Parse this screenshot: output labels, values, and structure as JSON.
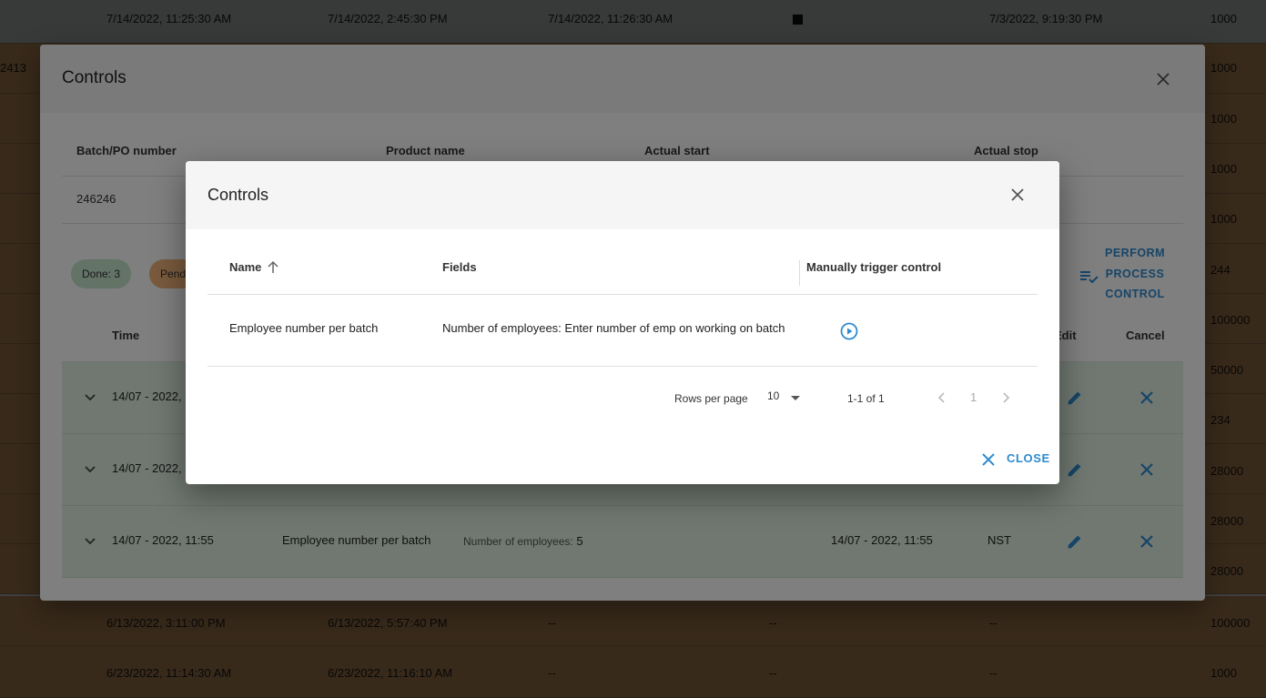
{
  "background_table": {
    "rows": [
      {
        "c1": "7/14/2022, 11:25:30 AM",
        "c2": "7/14/2022, 2:45:30 PM",
        "c3": "7/14/2022, 11:26:30 AM",
        "c5": "7/3/2022, 9:19:30 PM",
        "c6": "1000",
        "style": "green"
      },
      {
        "c1": "",
        "c2": "",
        "c3": "",
        "c5": "",
        "c6": "1000",
        "style": "orange",
        "c0": "2413"
      },
      {
        "c1": "",
        "c2": "",
        "c3": "",
        "c5": "",
        "c6": "1000",
        "style": "orange"
      },
      {
        "c1": "",
        "c2": "",
        "c3": "",
        "c5": "",
        "c6": "1000",
        "style": "orange"
      },
      {
        "c1": "",
        "c2": "",
        "c3": "",
        "c5": "",
        "c6": "1000",
        "style": "orange"
      },
      {
        "c1": "",
        "c2": "",
        "c3": "",
        "c5": "",
        "c6": "244",
        "style": "orange"
      },
      {
        "c1": "",
        "c2": "",
        "c3": "",
        "c5": "",
        "c6": "100000",
        "style": "orange"
      },
      {
        "c1": "",
        "c2": "",
        "c3": "",
        "c5": "",
        "c6": "50000",
        "style": "orange"
      },
      {
        "c1": "",
        "c2": "",
        "c3": "",
        "c5": "",
        "c6": "234",
        "style": "orange"
      },
      {
        "c1": "",
        "c2": "",
        "c3": "",
        "c5": "",
        "c6": "28000",
        "style": "orange"
      },
      {
        "c1": "",
        "c2": "",
        "c3": "",
        "c5": "",
        "c6": "28000",
        "style": "orange"
      },
      {
        "c1": "",
        "c2": "",
        "c3": "",
        "c5": "",
        "c6": "28000",
        "style": "orange"
      },
      {
        "c1": "6/13/2022, 3:11:00 PM",
        "c2": "6/13/2022, 5:57:40 PM",
        "c3": "--",
        "c4": "--",
        "c5": "--",
        "c6": "100000",
        "style": "orange"
      },
      {
        "c1": "6/23/2022, 11:14:30 AM",
        "c2": "6/23/2022, 11:16:10 AM",
        "c3": "--",
        "c4": "--",
        "c5": "--",
        "c6": "1000",
        "style": "orange"
      }
    ]
  },
  "outer_dialog": {
    "title": "Controls",
    "info_headers": [
      "Batch/PO number",
      "Product name",
      "Actual start",
      "Actual stop"
    ],
    "batch_number": "246246",
    "chip_done": "Done: 3",
    "chip_pending": "Pend",
    "perform_button_label": "PERFORM PROCESS CONTROL",
    "control_headers": {
      "time": "Time",
      "edit": "Edit",
      "cancel": "Cancel"
    },
    "control_rows": [
      {
        "time": "14/07 - 2022, 11:55",
        "name": "",
        "fields_label": "",
        "fields_value": "",
        "performed": "",
        "user": ""
      },
      {
        "time": "14/07 - 2022, 11:55",
        "name": "",
        "fields_label": "",
        "fields_value": "",
        "performed": "",
        "user": ""
      },
      {
        "time": "14/07 - 2022, 11:55",
        "name": "Employee number per batch",
        "fields_label": "Number of employees:",
        "fields_value": "5",
        "performed": "14/07 - 2022, 11:55",
        "user": "NST"
      }
    ]
  },
  "inner_dialog": {
    "title": "Controls",
    "headers": {
      "name": "Name",
      "fields": "Fields",
      "trigger": "Manually trigger control"
    },
    "rows": [
      {
        "name": "Employee number per batch",
        "fields": "Number of employees: Enter number of emp on working on batch"
      }
    ],
    "pagination": {
      "rows_per_page_label": "Rows per page",
      "rows_per_page": "10",
      "range": "1-1 of 1",
      "page": "1"
    },
    "close_label": "CLOSE"
  },
  "colors": {
    "accent": "#2d8bd0",
    "row_green": "#e0f0e2",
    "chip_done": "#c7e6cd",
    "chip_pending": "#f2b57a",
    "bg_orange": "#e3a86a"
  }
}
